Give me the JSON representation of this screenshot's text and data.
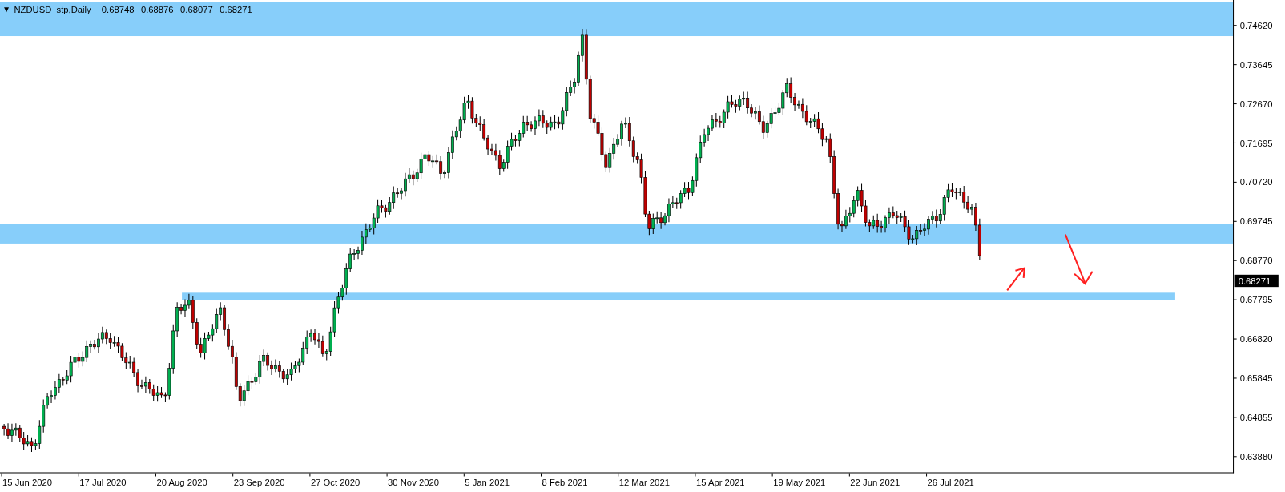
{
  "chart": {
    "collapse_marker": "▼",
    "symbol": "NZDUSD_stp,Daily",
    "ohlc": [
      "0.68748",
      "0.68876",
      "0.68077",
      "0.68271"
    ],
    "price_axis": [
      "0.74620",
      "0.73645",
      "0.72670",
      "0.71695",
      "0.70720",
      "0.69745",
      "0.68770",
      "0.67795",
      "0.66820",
      "0.65845",
      "0.64855",
      "0.63880"
    ],
    "current_price": "0.68271",
    "date_axis": [
      "15 Jun 2020",
      "17 Jul 2020",
      "20 Aug 2020",
      "23 Sep 2020",
      "27 Oct 2020",
      "30 Nov 2020",
      "5 Jan 2021",
      "8 Feb 2021",
      "12 Mar 2021",
      "15 Apr 2021",
      "19 May 2021",
      "22 Jun 2021",
      "26 Jul 2021"
    ]
  }
}
